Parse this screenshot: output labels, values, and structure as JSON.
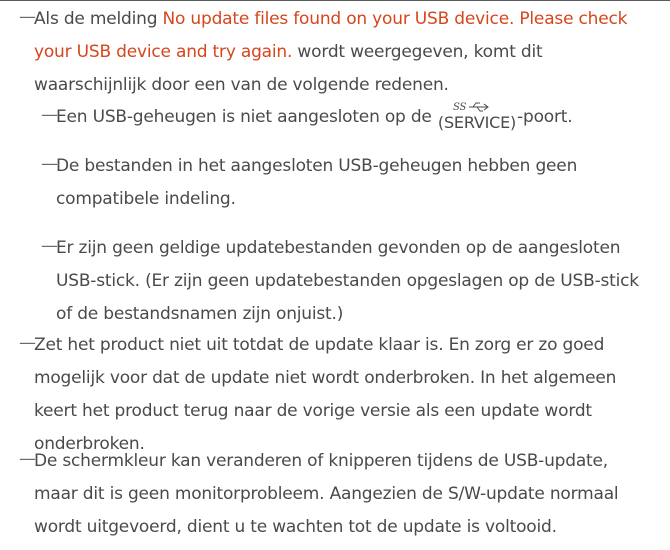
{
  "note1": {
    "prefix": "Als de melding ",
    "highlight": "No update files found on your USB device. Please check your USB device and try again.",
    "suffix": " wordt weergegeven, komt dit waarschijnlijk door een van de volgende redenen."
  },
  "sub1": {
    "prefix": "Een USB-geheugen is niet aangesloten op de ",
    "port_label": "(SERVICE)",
    "suffix": "-poort."
  },
  "sub2": {
    "text": "De bestanden in het aangesloten USB-geheugen hebben geen compatibele indeling."
  },
  "sub3": {
    "text": "Er zijn geen geldige updatebestanden gevonden op de aangesloten USB-stick. (Er zijn geen updatebestanden opgeslagen op de USB-stick of de bestandsnamen zijn onjuist.)"
  },
  "note2": {
    "text": "Zet het product niet uit totdat de update klaar is. En zorg er zo goed mogelijk voor dat de update niet wordt onderbroken. In het algemeen keert het product terug naar de vorige versie als een update wordt onderbroken."
  },
  "note3": {
    "text": "De schermkleur kan veranderen of knipperen tijdens de USB-update, maar dit is geen monitorprobleem. Aangezien de S/W-update normaal wordt uitgevoerd, dient u te wachten tot de update is voltooid."
  },
  "dash_glyph": "—",
  "icons": {
    "usb": "usb-superspeed-icon"
  },
  "colors": {
    "highlight": "#d5461c",
    "text": "#4a4a4a"
  }
}
